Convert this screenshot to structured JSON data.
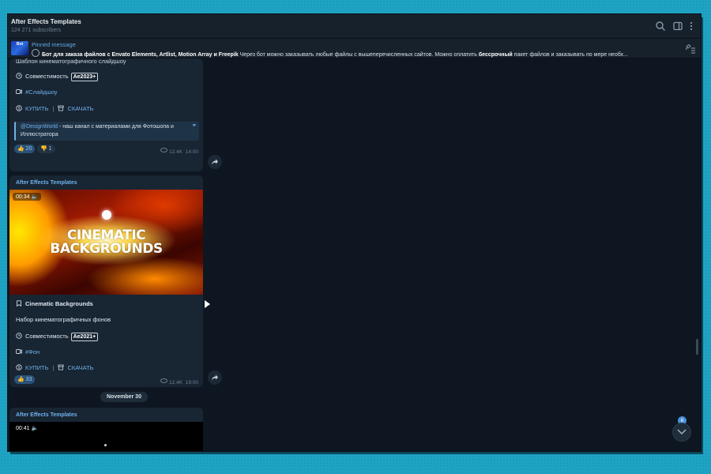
{
  "header": {
    "title": "After Effects Templates",
    "subscribers": "124 271 subscribers"
  },
  "pinned": {
    "thumb_text": "Bot",
    "label": "Pinned message",
    "text_bold1": "Бот для заказа файлов с Envato Elements, Artlist,  Motion Array и Freepik",
    "text_mid": " Через бот можно заказывать любые файлы с вышеперечисленных сайтов. Можно оплатить ",
    "text_bold2": "бессрочный",
    "text_end": " пакет файлов и заказывать по мере необх..."
  },
  "post1": {
    "cut_title": "Шаблон кинематографичного слайдшоу",
    "compat_label": "Совместимость",
    "compat_badge": "Ae2023+",
    "hashtag": "#Слайдшоу",
    "buy": "КУПИТЬ",
    "download": "СКАЧАТЬ",
    "quote_handle": "@DesignWorld",
    "quote_text": " - наш канал с материалами для Фотошопа и Иллюстратора",
    "reaction1": "20",
    "reaction2": "1",
    "views": "12.4K",
    "time": "14:00"
  },
  "post2": {
    "author": "After Effects Templates",
    "video_time": "00:34",
    "media_line1": "CINEMATIC",
    "media_line2": "BACKGROUNDS",
    "title": "Cinematic Backgrounds",
    "desc": "Набор кинематографичных фонов",
    "compat_label": "Совместимость",
    "compat_badge": "Ae2021+",
    "hashtag": "#Фон",
    "buy": "КУПИТЬ",
    "download": "СКАЧАТЬ",
    "reaction1": "33",
    "views": "12.4K",
    "time": "19:00"
  },
  "date_separator": "November 30",
  "post3": {
    "author": "After Effects Templates",
    "video_time": "00:41"
  },
  "unread_count": "6",
  "colors": {
    "accent": "#6fb1ea",
    "window_bg": "#0e1621",
    "bubble_bg": "#182533",
    "outer_bg": "#1fa3c4"
  }
}
